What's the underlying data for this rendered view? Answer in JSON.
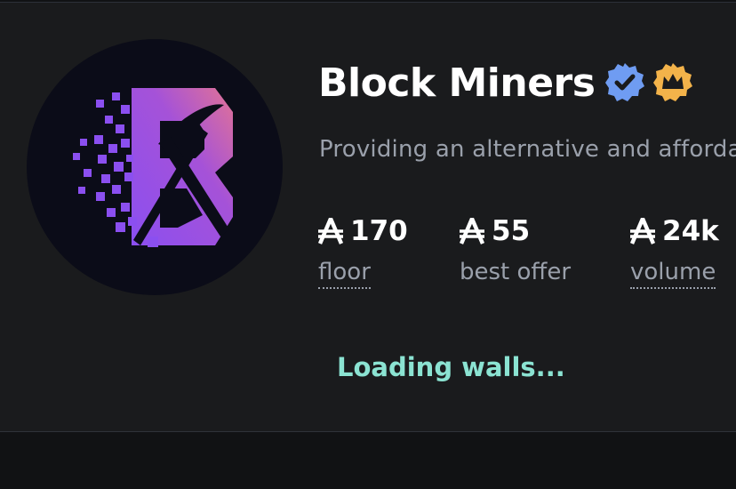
{
  "collection": {
    "name": "Block Miners",
    "description": "Providing an alternative and affordable",
    "verified_badge_icon": "verified-check-badge",
    "crown_badge_icon": "gold-crown-badge",
    "logo_icon": "block-miners-pickaxe-logo"
  },
  "stats": [
    {
      "currency_symbol": "₳",
      "value": "170",
      "label": "floor"
    },
    {
      "currency_symbol": "₳",
      "value": "55",
      "label": "best offer"
    },
    {
      "currency_symbol": "₳",
      "value": "24k",
      "label": "volume"
    }
  ],
  "status": {
    "loading_text": "Loading walls..."
  },
  "colors": {
    "background": "#1a1b1d",
    "verified_blue": "#6f9cf2",
    "crown_gold": "#f3b34a",
    "loading_teal": "#8be3d2",
    "logo_purple": "#9a4ee6",
    "logo_pink": "#d96a9c"
  }
}
